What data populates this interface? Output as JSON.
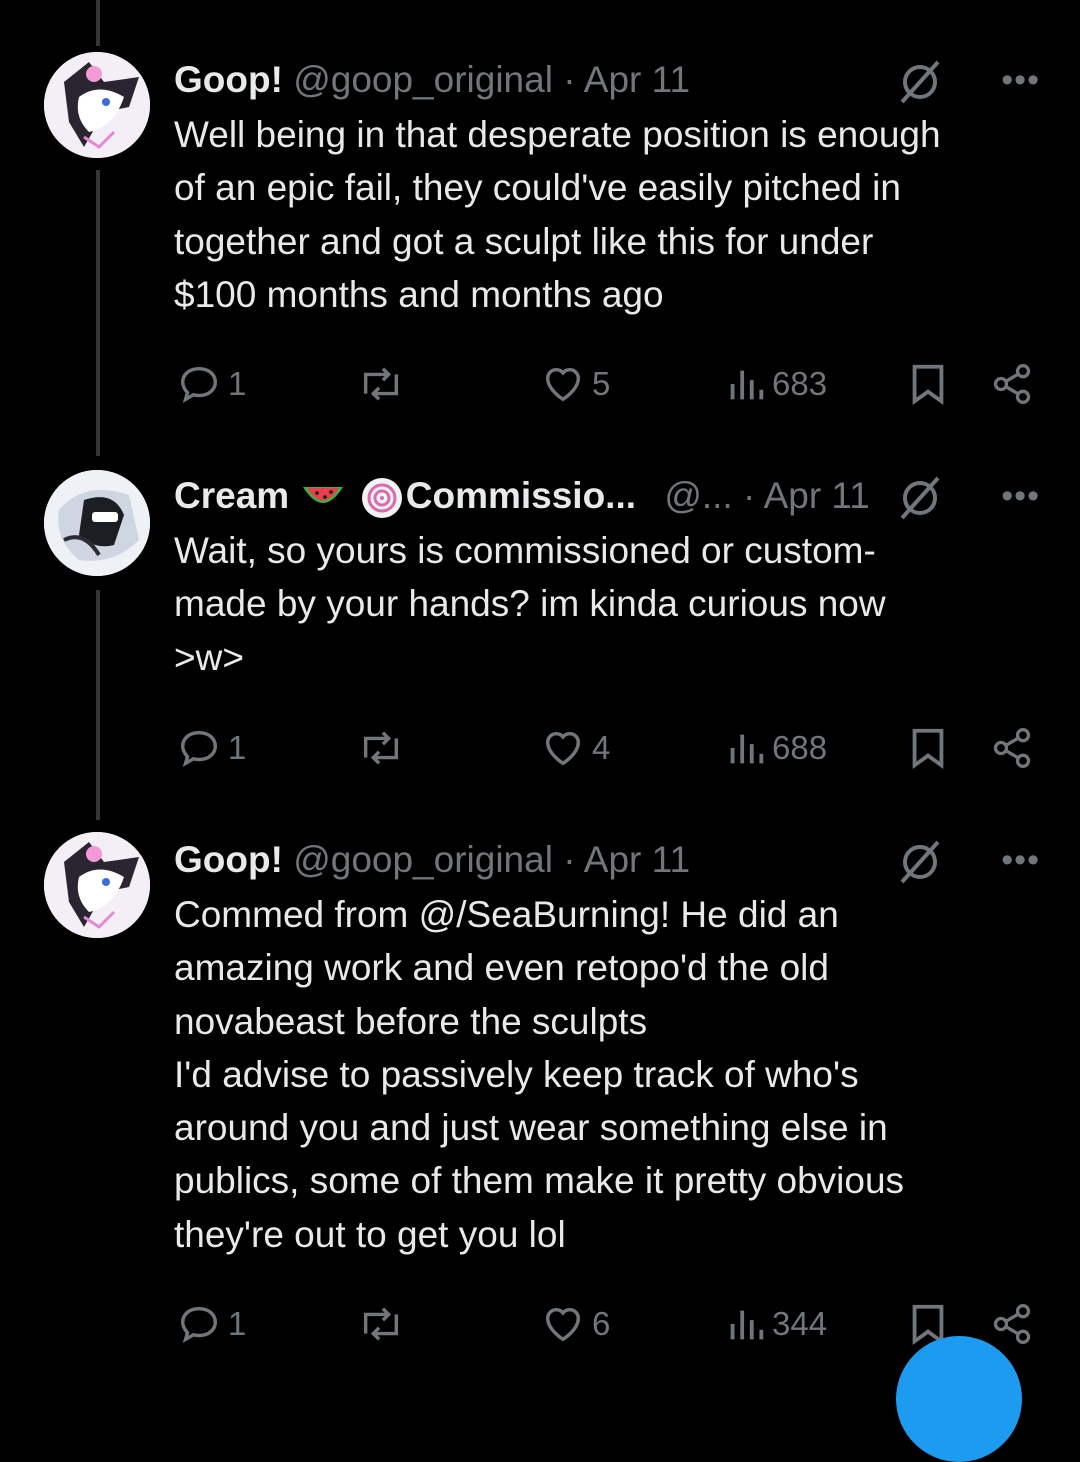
{
  "tweets": [
    {
      "name": "Goop!",
      "handle": "@goop_original",
      "sep": "·",
      "time": "Apr 11",
      "text": "Well being in that desperate position is enough\nof an epic fail, they could've easily pitched in\ntogether and got a sculpt like this for under\n$100 months and months ago",
      "replies": "1",
      "likes": "5",
      "views": "683"
    },
    {
      "name": "Cream",
      "name_suffix": "Commissio...",
      "handle": "@...",
      "sep": "·",
      "time": "Apr 11",
      "text": "Wait, so yours is commissioned or custom-\nmade by your hands? im kinda curious now\n>w>",
      "replies": "1",
      "likes": "4",
      "views": "688"
    },
    {
      "name": "Goop!",
      "handle": "@goop_original",
      "sep": "·",
      "time": "Apr 11",
      "text": "Commed from @/SeaBurning! He did an\namazing work and even retopo'd the old\nnovabeast before the sculpts\nI'd advise to passively keep track of who's\naround you and just wear something else in\npublics, some of them make it pretty obvious\nthey're out to get you lol",
      "replies": "1",
      "likes": "6",
      "views": "344"
    }
  ],
  "icons": {
    "reply": "reply-icon",
    "repost": "repost-icon",
    "like": "heart-icon",
    "views": "views-icon",
    "bookmark": "bookmark-icon",
    "share": "share-icon",
    "grok": "grok-icon",
    "more": "more-icon"
  },
  "more_label": "•••",
  "colors": {
    "background": "#000000",
    "text": "#e7e9ea",
    "muted": "#71767b",
    "accent": "#1d9bf0"
  }
}
